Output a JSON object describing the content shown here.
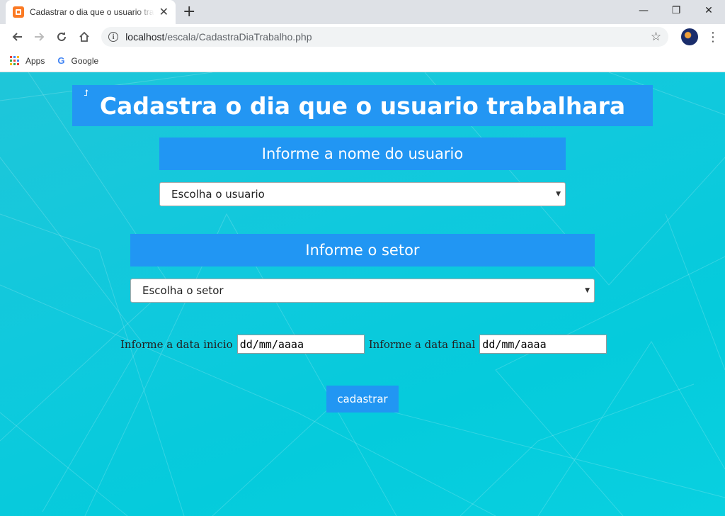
{
  "browser": {
    "tab_title": "Cadastrar o dia que o usuario trabalhara",
    "tab_close": "✕",
    "new_tab": "+",
    "url_host": "localhost",
    "url_path": "/escala/CadastraDiaTrabalho.php",
    "bookmarks": [
      {
        "label": "Apps",
        "icon": "apps-grid-icon"
      },
      {
        "label": "Google",
        "icon": "google-g-icon"
      }
    ],
    "window_controls": {
      "minimize": "—",
      "restore": "❐",
      "close": "✕"
    }
  },
  "page": {
    "title": "Cadastra o dia que o usuario trabalhara",
    "user_section": {
      "label": "Informe a nome do usuario",
      "select_value": "Escolha o usuario"
    },
    "sector_section": {
      "label": "Informe o setor",
      "select_value": "Escolha o setor"
    },
    "dates": {
      "start_label": "Informe a data inicio",
      "start_placeholder": "dd/mm/aaaa",
      "end_label": "Informe a data final",
      "end_placeholder": "dd/mm/aaaa"
    },
    "submit_label": "cadastrar"
  },
  "colors": {
    "accent": "#2196f3",
    "background": "#10c9dd"
  }
}
